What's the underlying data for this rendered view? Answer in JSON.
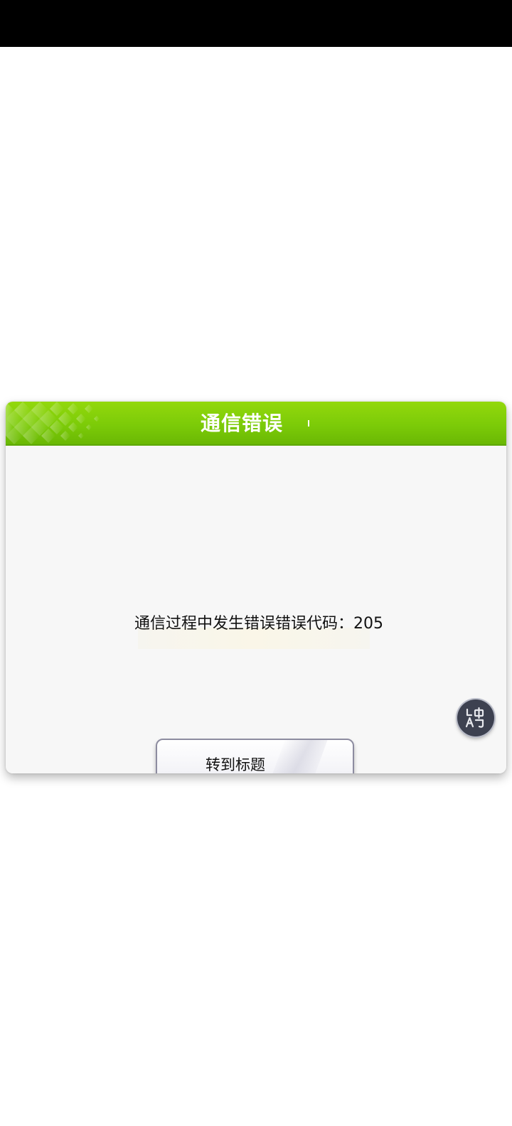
{
  "dialog": {
    "title": "通信错误",
    "message": "通信过程中发生错误错误代码：205",
    "button_label": "转到标题"
  },
  "icons": {
    "translate": "translate-icon"
  },
  "colors": {
    "header_green": "#7ccb08",
    "dialog_bg": "#f7f7f7",
    "fab_bg": "#3d4150"
  }
}
